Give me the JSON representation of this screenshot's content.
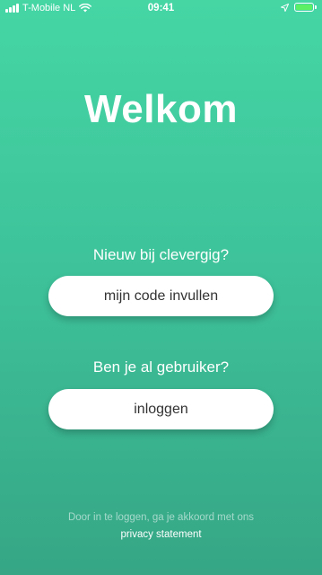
{
  "status_bar": {
    "carrier": "T-Mobile NL",
    "time": "09:41",
    "battery_level": 1.0,
    "battery_color": "#5cf064"
  },
  "welcome": {
    "title": "Welkom"
  },
  "new_user": {
    "prompt": "Nieuw bij clevergig?",
    "button_label": "mijn code invullen"
  },
  "existing_user": {
    "prompt": "Ben je al gebruiker?",
    "button_label": "inloggen"
  },
  "footer": {
    "text": "Door in te loggen, ga je akkoord met ons",
    "link_label": "privacy statement"
  },
  "colors": {
    "gradient_top": "#45d6a4",
    "gradient_bottom": "#36a685",
    "button_bg": "#ffffff",
    "button_text": "#333333"
  },
  "icons": {
    "signal": "cellular-signal-icon",
    "wifi": "wifi-icon",
    "location": "location-arrow-icon",
    "battery": "battery-icon"
  }
}
